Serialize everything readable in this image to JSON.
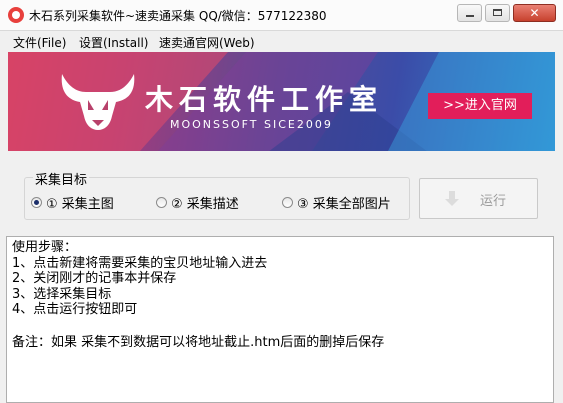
{
  "window": {
    "title": "木石系列采集软件~速卖通采集 QQ/微信：577122380",
    "controls": [
      "minimize-icon",
      "maximize-icon",
      "close-icon"
    ]
  },
  "menu": {
    "items": [
      "文件(File)",
      "设置(Install)",
      "速卖通官网(Web)"
    ]
  },
  "banner": {
    "brand_name": "木石软件工作室",
    "brand_sub": "MOONSSOFT SICE2009",
    "cta": ">>进入官网",
    "colors": {
      "cta": "#e21e5a",
      "left": "#c73b64",
      "right": "#2d8fd0"
    }
  },
  "target": {
    "legend": "采集目标",
    "options": [
      {
        "label": "① 采集主图",
        "checked": true
      },
      {
        "label": "② 采集描述",
        "checked": false
      },
      {
        "label": "③ 采集全部图片",
        "checked": false
      }
    ]
  },
  "run_button": {
    "label": "运行",
    "enabled": false
  },
  "instructions": {
    "lines": [
      "使用步骤：",
      "1、点击新建将需要采集的宝贝地址输入进去",
      "2、关闭刚才的记事本并保存",
      "3、选择采集目标",
      "4、点击运行按钮即可"
    ],
    "note": "备注：如果 采集不到数据可以将地址截止.htm后面的删掉后保存"
  }
}
